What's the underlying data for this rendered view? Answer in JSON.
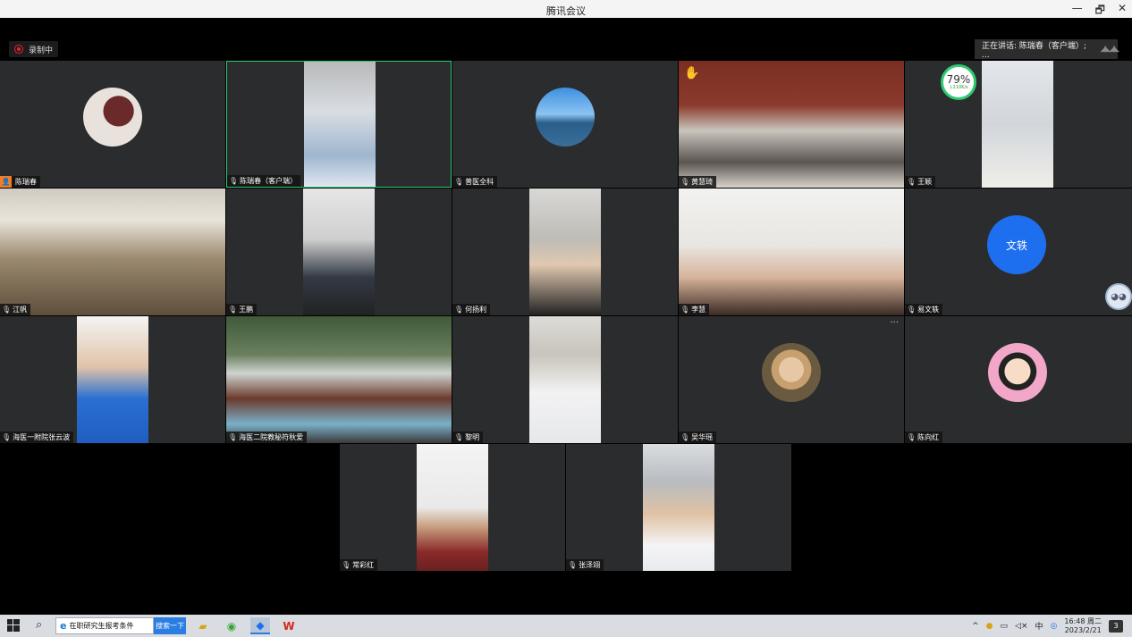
{
  "window": {
    "title": "腾讯会议",
    "minimize": "—",
    "restore": "🗗",
    "close": "✕"
  },
  "topbar": {
    "recording_label": "录制中",
    "speaking_label": "正在讲话: 陈瑞春（客户端）; ...",
    "speaking_waves": "◢◣◢◣"
  },
  "participants": [
    {
      "name": "陈瑞春",
      "host": true
    },
    {
      "name": "陈瑞春（客户端）",
      "active": true
    },
    {
      "name": "普医全科"
    },
    {
      "name": "黄慧琦",
      "hand": true
    },
    {
      "name": "王颖"
    },
    {
      "name": "江帆"
    },
    {
      "name": "王鹏"
    },
    {
      "name": "何扬利"
    },
    {
      "name": "李慧"
    },
    {
      "name": "易文轶"
    },
    {
      "name": "海医一附院张云波"
    },
    {
      "name": "海医二院教秘符秋爱"
    },
    {
      "name": "黎明"
    },
    {
      "name": "吴华瑶"
    },
    {
      "name": "陈向红"
    },
    {
      "name": "常彩红"
    },
    {
      "name": "张泽翊"
    }
  ],
  "network": {
    "percent": "79%",
    "speed": "↓210K/s"
  },
  "text_avatar": "文轶",
  "more_menu": "···",
  "hand_icon": "✋",
  "host_icon": "👤",
  "mic_icon": "🎙",
  "taskbar": {
    "search_text": "在职研究生报考条件",
    "search_button": "搜索一下",
    "ime": "中",
    "time": "16:48 周二",
    "date": "2023/2/21",
    "notifications": "3",
    "tray_chevron": "^"
  }
}
